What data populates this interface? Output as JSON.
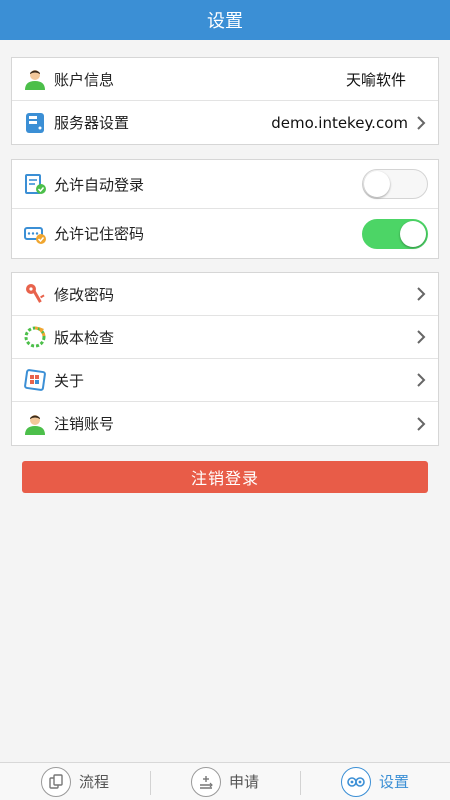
{
  "header": {
    "title": "设置"
  },
  "account": {
    "rows": [
      {
        "label": "账户信息",
        "value": "天喻软件"
      },
      {
        "label": "服务器设置",
        "value": "demo.intekey.com"
      }
    ]
  },
  "login_options": {
    "rows": [
      {
        "label": "允许自动登录",
        "enabled": false
      },
      {
        "label": "允许记住密码",
        "enabled": true
      }
    ]
  },
  "menu": {
    "rows": [
      {
        "label": "修改密码",
        "icon": "key-icon"
      },
      {
        "label": "版本检查",
        "icon": "version-check-icon"
      },
      {
        "label": "关于",
        "icon": "about-icon"
      },
      {
        "label": "注销账号",
        "icon": "user-icon"
      }
    ]
  },
  "logout_button": {
    "label": "注销登录"
  },
  "tabbar": {
    "tabs": [
      {
        "label": "流程",
        "icon": "flow-icon"
      },
      {
        "label": "申请",
        "icon": "apply-icon"
      },
      {
        "label": "设置",
        "icon": "settings-icon",
        "active": true
      }
    ]
  },
  "colors": {
    "header": "#3b8fd5",
    "toggle_on": "#4cd566",
    "logout_button": "#e85c48"
  }
}
